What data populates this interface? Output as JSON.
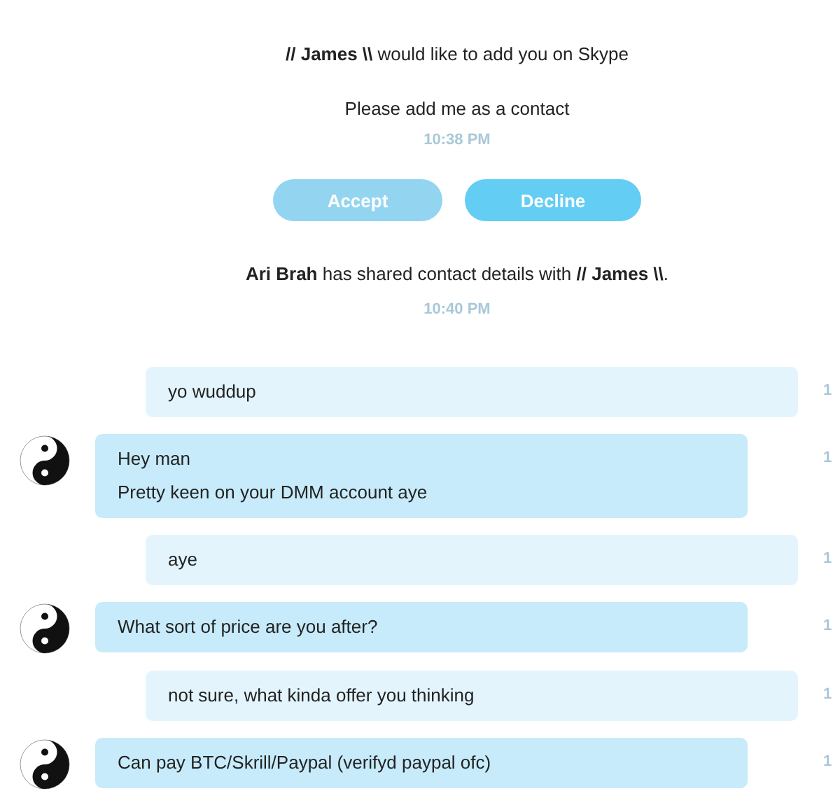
{
  "request": {
    "text": "**// James \\\\** would like to add you on Skype",
    "message": "Please add me as a contact",
    "time": "10:38 PM"
  },
  "buttons": [
    {
      "label": "Accept",
      "kind": "accept"
    },
    {
      "label": "Decline",
      "kind": "decline"
    }
  ],
  "share": {
    "text": "**Ari Brah** has shared contact details with **// James \\\\**.",
    "time": "10:40 PM"
  },
  "messages": [
    {
      "kind": "outgoing",
      "lines": [
        "yo wuddup"
      ],
      "time": "1"
    },
    {
      "kind": "incoming",
      "lines": [
        "Hey man",
        "Pretty keen on your DMM account aye"
      ],
      "time": "1"
    },
    {
      "kind": "outgoing",
      "lines": [
        "aye"
      ],
      "time": "1"
    },
    {
      "kind": "incoming",
      "lines": [
        "What sort of price are you after?"
      ],
      "time": "1"
    },
    {
      "kind": "outgoing",
      "lines": [
        "not sure, what kinda offer you thinking"
      ],
      "time": "1"
    },
    {
      "kind": "incoming",
      "lines": [
        "Can pay BTC/Skrill/Paypal (verifyd paypal ofc)"
      ],
      "time": "1"
    }
  ]
}
